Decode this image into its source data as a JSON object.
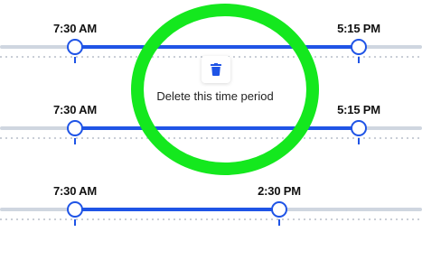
{
  "schedule": {
    "rows": [
      {
        "start_label": "7:30 AM",
        "end_label": "5:15 PM"
      },
      {
        "start_label": "7:30 AM",
        "end_label": "5:15 PM"
      },
      {
        "start_label": "7:30 AM",
        "end_label": "2:30 PM"
      }
    ]
  },
  "tooltip": {
    "text": "Delete this time period",
    "icon": "trash-icon"
  },
  "colors": {
    "accent": "#1f54e6",
    "track": "#cfd6e0",
    "highlight": "#14e81e"
  }
}
